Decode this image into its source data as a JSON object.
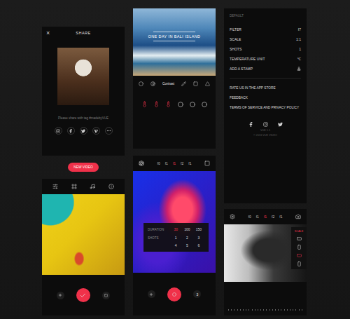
{
  "share_screen": {
    "close": "×",
    "title": "SHARE",
    "hint": "Please share with tag #madebyVUE"
  },
  "new_video_button": "NEW VIDEO",
  "stamp_screen": {
    "caption": "ONE DAY IN BALI ISLAND",
    "tool_label": "Contrast",
    "marks": [
      {
        "active": true
      },
      {
        "active": true
      },
      {
        "active": true
      },
      {
        "active": false
      },
      {
        "active": false
      },
      {
        "active": false
      }
    ]
  },
  "camera_screen": {
    "filters": [
      {
        "label": "f0",
        "selected": false
      },
      {
        "label": "f1",
        "selected": false
      },
      {
        "label": "f1",
        "selected": true
      },
      {
        "label": "f2",
        "selected": false
      },
      {
        "label": "f1",
        "selected": false
      }
    ],
    "duration": {
      "label": "DURATION",
      "options": [
        {
          "label": "30",
          "selected": true
        },
        {
          "label": "100",
          "selected": false
        },
        {
          "label": "150",
          "selected": false
        }
      ]
    },
    "shots": {
      "label": "SHOTS",
      "options": [
        "1",
        "2",
        "3",
        "4",
        "5",
        "6"
      ]
    },
    "counter": "3"
  },
  "settings": {
    "header": "DEFAULT",
    "rows": [
      {
        "label": "FILTER",
        "kind": "value",
        "value": "f7"
      },
      {
        "label": "SCALE",
        "kind": "value",
        "value": "1:1"
      },
      {
        "label": "SHOTS",
        "kind": "value",
        "value": "1"
      },
      {
        "label": "TEMPERATURE UNIT",
        "kind": "value",
        "value": "℃"
      },
      {
        "label": "ADD A STAMP",
        "kind": "icon",
        "value": ""
      }
    ],
    "links": [
      "RATE US IN THE APP STORE",
      "FEEDBACK",
      "TERMS OF SERVICE AND PRIVACY POLICY"
    ],
    "version": "VUE 1.1",
    "copyright": "© 2016 VUE VIDEO"
  },
  "scale_screen": {
    "filters": [
      {
        "label": "f0",
        "selected": false
      },
      {
        "label": "f1",
        "selected": false
      },
      {
        "label": "f1",
        "selected": true
      },
      {
        "label": "f2",
        "selected": false
      },
      {
        "label": "f1",
        "selected": false
      }
    ],
    "menu_title": "SCALE",
    "options": [
      {
        "selected": false
      },
      {
        "selected": false
      },
      {
        "selected": true
      },
      {
        "selected": false
      }
    ]
  }
}
